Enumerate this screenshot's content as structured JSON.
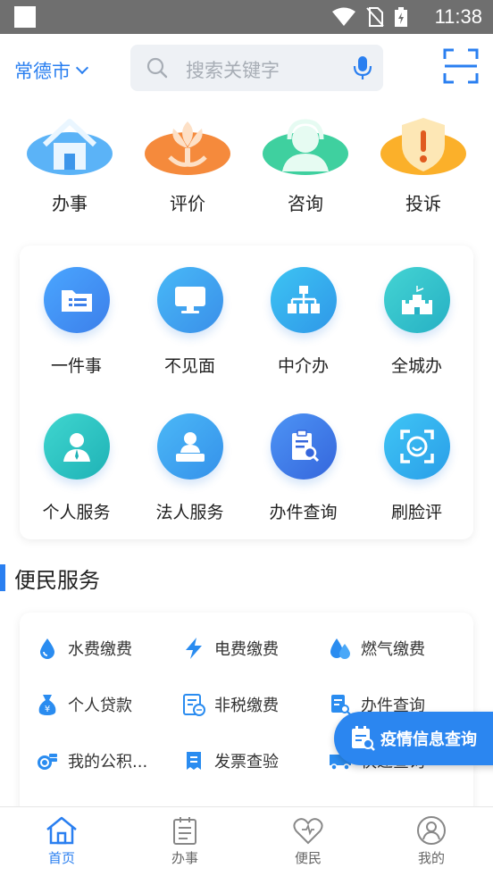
{
  "status_bar": {
    "time": "11:38"
  },
  "header": {
    "city": "常德市",
    "search_placeholder": "搜索关键字"
  },
  "top_actions": [
    {
      "label": "办事",
      "icon": "house-icon"
    },
    {
      "label": "评价",
      "icon": "flower-icon"
    },
    {
      "label": "咨询",
      "icon": "headset-agent-icon"
    },
    {
      "label": "投诉",
      "icon": "warning-shield-icon"
    }
  ],
  "grid_services": [
    {
      "label": "一件事",
      "icon": "folder-list-icon"
    },
    {
      "label": "不见面",
      "icon": "monitor-icon"
    },
    {
      "label": "中介办",
      "icon": "org-chart-icon"
    },
    {
      "label": "全城办",
      "icon": "castle-icon"
    },
    {
      "label": "个人服务",
      "icon": "person-icon"
    },
    {
      "label": "法人服务",
      "icon": "person-desk-icon"
    },
    {
      "label": "办件查询",
      "icon": "clipboard-search-icon"
    },
    {
      "label": "刷脸评",
      "icon": "face-scan-icon"
    }
  ],
  "section_title": "便民服务",
  "convenience_services": [
    {
      "label": "水费缴费",
      "icon": "water-drop-icon"
    },
    {
      "label": "电费缴费",
      "icon": "lightning-icon"
    },
    {
      "label": "燃气缴费",
      "icon": "flame-icon"
    },
    {
      "label": "个人贷款",
      "icon": "money-bag-icon"
    },
    {
      "label": "非税缴费",
      "icon": "receipt-icon"
    },
    {
      "label": "办件查询",
      "icon": "document-search-icon"
    },
    {
      "label": "我的公积...",
      "icon": "coins-icon"
    },
    {
      "label": "发票查验",
      "icon": "invoice-icon"
    },
    {
      "label": "快递查询",
      "icon": "truck-icon"
    }
  ],
  "floating_button": {
    "label": "疫情信息查询"
  },
  "bottom_nav": [
    {
      "label": "首页",
      "active": true
    },
    {
      "label": "办事",
      "active": false
    },
    {
      "label": "便民",
      "active": false
    },
    {
      "label": "我的",
      "active": false
    }
  ],
  "colors": {
    "accent": "#2a7ff0",
    "status_bar": "#6f6f6f"
  }
}
